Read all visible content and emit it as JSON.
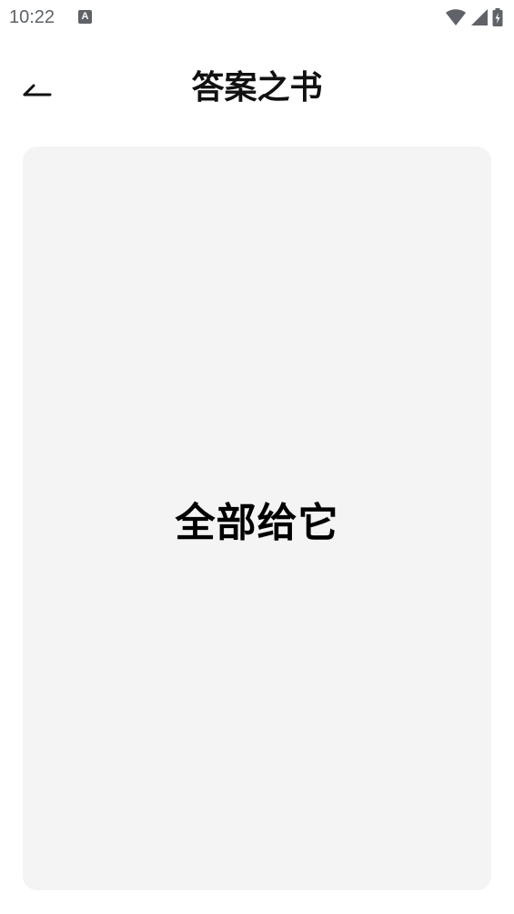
{
  "status_bar": {
    "time": "10:22",
    "notification_icon": "a-icon",
    "wifi_icon": "wifi-icon",
    "signal_icon": "cell-signal-icon",
    "battery_icon": "battery-charging-icon",
    "icon_color": "#5f6368"
  },
  "header": {
    "title": "答案之书",
    "back_icon": "back-arrow-icon"
  },
  "card": {
    "answer": "全部给它",
    "background_color": "#f4f4f4"
  },
  "notification": {
    "glyph": "A"
  }
}
